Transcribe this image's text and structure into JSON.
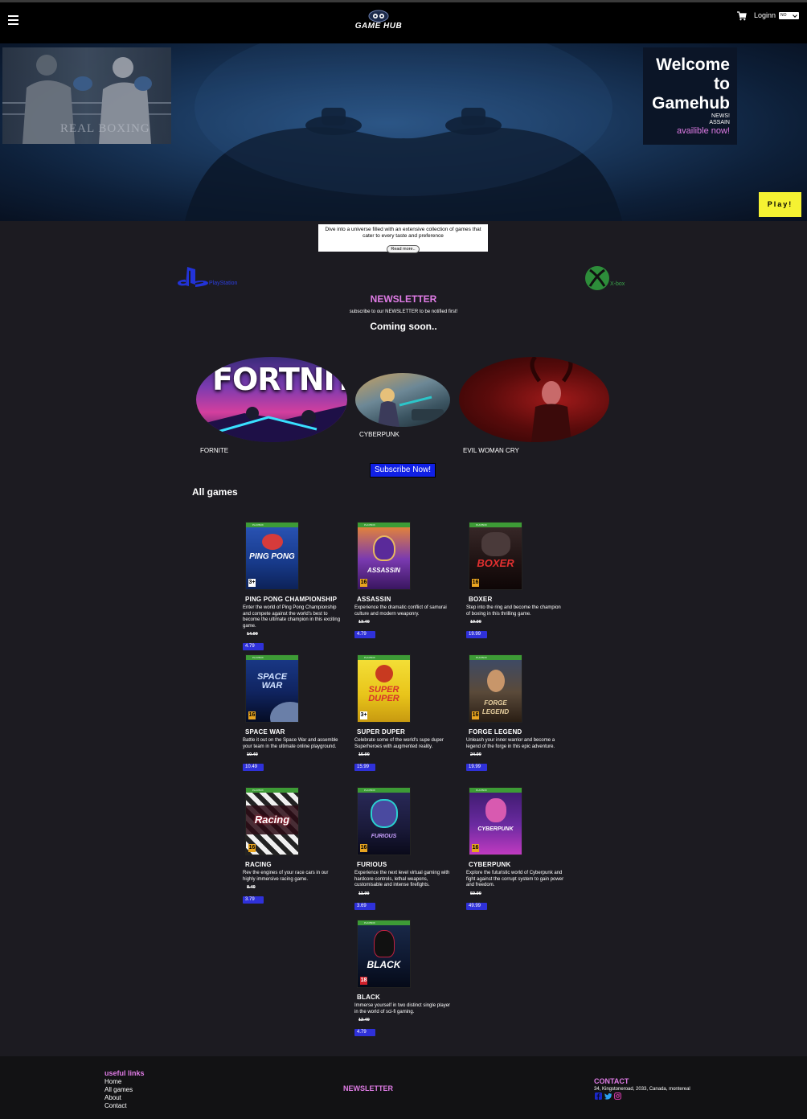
{
  "header": {
    "logo_text": "GAME HUB",
    "login_label": "Loginn",
    "language": "NO"
  },
  "hero": {
    "boxing_text": "REAL BOXING",
    "welcome_title": "Welcome to Gamehub",
    "news_label": "NEWS!",
    "news_game": "ASSAIN",
    "available_text": "availible now!",
    "play_label": "Play!"
  },
  "intro": {
    "text": "Dive into a universe filled with an extensive collection of games that cater to every taste and preference",
    "read_more_label": "Read more.."
  },
  "platforms": {
    "playstation_label": "PlayStation",
    "xbox_label": "X-box"
  },
  "newsletter": {
    "title": "NEWSLETTER",
    "subtitle": "subscribe to our NEWSLETTER to be notified first!",
    "coming_soon": "Coming soon..",
    "upcoming": [
      {
        "name": "FORNITE",
        "cover_text": "FORTNITE"
      },
      {
        "name": "CYBERPUNK"
      },
      {
        "name": "EVIL WOMAN CRY"
      }
    ],
    "subscribe_label": "Subscribe Now!"
  },
  "all_games": {
    "title": "All games",
    "items": [
      {
        "name": "PING PONG CHAMPIONSHIP",
        "cover_text": "PING PONG",
        "rating": "3+",
        "desc": "Enter the world of Ping Pong Championship and compete against the world's best to become the ultimate champion in this exciting game.",
        "old_price": "14.99",
        "price": "4.79"
      },
      {
        "name": "ASSASSIN",
        "cover_text": "ASSASSIN",
        "rating": "16",
        "desc": "Experience the dramatic conflict of samurai culture and modern weaponry.",
        "old_price": "13.49",
        "price": "4.79"
      },
      {
        "name": "BOXER",
        "cover_text": "BOXER",
        "rating": "16",
        "desc": "Step into the ring and become the champion of boxing in this thrilling game.",
        "old_price": "19.99",
        "price": "19.99"
      },
      {
        "name": "SPACE WAR",
        "cover_text": "SPACE WAR",
        "rating": "16",
        "desc": "Battle it out on the Space War and assemble your team in the ultimate online playground.",
        "old_price": "10.49",
        "price": "10.49"
      },
      {
        "name": "SUPER DUPER",
        "cover_text": "SUPER DUPER",
        "rating": "3+",
        "desc": "Celebrate some of the world's supe duper Superheroes with augmented reality.",
        "old_price": "15.99",
        "price": "15.99"
      },
      {
        "name": "FORGE LEGEND",
        "cover_text": "FORGE LEGEND",
        "rating": "16",
        "desc": "Unleash your inner warrior and become a legend of the forge in this epic adventure.",
        "old_price": "24.99",
        "price": "19.99"
      },
      {
        "name": "RACING",
        "cover_text": "Racing",
        "rating": "16",
        "desc": "Rev the engines of your race cars in our highly immersive racing game.",
        "old_price": "8.49",
        "price": "3.79"
      },
      {
        "name": "FURIOUS",
        "cover_text": "FURIOUS",
        "rating": "16",
        "desc": "Experience the next level virtual gaming with hardcore controls, lethal weapons, customisable and intense firefights.",
        "old_price": "11.99",
        "price": "3.69"
      },
      {
        "name": "CYBERPUNK",
        "cover_text": "CYBERPUNK",
        "rating": "16",
        "desc": "Explore the futuristic world of Cyberpunk and fight against the corrupt system to gain power and freedom.",
        "old_price": "59.99",
        "price": "49.99"
      },
      {
        "name": "BLACK",
        "cover_text": "BLACK",
        "rating": "18",
        "desc": "Immerse yourself in two distinct single player in the world of sci-fi gaming.",
        "old_price": "12.49",
        "price": "4.79"
      }
    ]
  },
  "footer": {
    "links_title": "useful links",
    "links": [
      "Home",
      "All games",
      "About",
      "Contact"
    ],
    "newsletter_title": "NEWSLETTER",
    "contact_title": "CONTACT",
    "address": "34, Kingstoneroad, 2033, Canada, montereal"
  },
  "colors": {
    "accent_pink": "#e07ce6",
    "price_blue": "#2f31d9",
    "play_yellow": "#f5f232",
    "subscribe_blue": "#1020e6"
  }
}
